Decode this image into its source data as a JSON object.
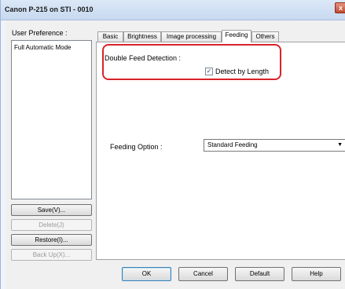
{
  "window": {
    "title": "Canon P-215 on STI - 0010",
    "close_label": "x"
  },
  "sidebar": {
    "label": "User Preference :",
    "items": [
      "Full Automatic Mode"
    ],
    "buttons": {
      "save": "Save(V)...",
      "delete": "Delete(J)",
      "restore": "Restore(I)...",
      "backup": "Back Up(X)..."
    }
  },
  "tabs": [
    "Basic",
    "Brightness",
    "Image processing",
    "Feeding",
    "Others"
  ],
  "active_tab": "Feeding",
  "feeding": {
    "double_feed_label": "Double Feed Detection :",
    "detect_by_length_label": "Detect by Length",
    "detect_by_length_checked": true,
    "check_mark": "✓",
    "feeding_option_label": "Feeding Option :",
    "feeding_option_value": "Standard Feeding",
    "dropdown_arrow": "▼"
  },
  "buttons": {
    "ok": "OK",
    "cancel": "Cancel",
    "default": "Default",
    "help": "Help"
  },
  "colors": {
    "highlight": "#d8232a",
    "titlebar": "#dbe8f7"
  }
}
